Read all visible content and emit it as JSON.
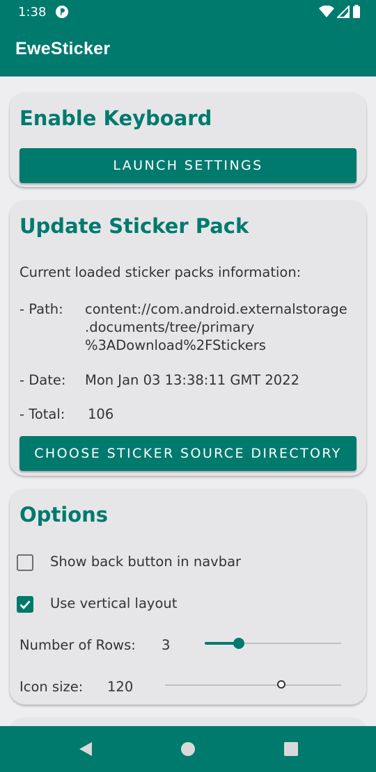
{
  "status": {
    "time": "1:38"
  },
  "app": {
    "title": "EweSticker"
  },
  "enable_keyboard": {
    "title": "Enable Keyboard",
    "button": "LAUNCH SETTINGS"
  },
  "update_pack": {
    "title": "Update Sticker Pack",
    "intro": "Current loaded sticker packs information:",
    "path_label": "- Path:",
    "path_lines": [
      "content://com.android.externalstorage",
      ".documents/tree/primary",
      "%3ADownload%2FStickers"
    ],
    "date_label": "- Date:",
    "date_value": "Mon Jan 03 13:38:11 GMT 2022",
    "total_label": "- Total:",
    "total_value": "106",
    "button": "CHOOSE STICKER SOURCE DIRECTORY"
  },
  "options": {
    "title": "Options",
    "show_back": {
      "label": "Show back button in navbar",
      "checked": false
    },
    "vertical": {
      "label": "Use vertical layout",
      "checked": true
    },
    "rows": {
      "label": "Number of Rows:",
      "value": "3",
      "fraction": 0.25
    },
    "icon_size": {
      "label": "Icon size:",
      "value": "120",
      "fraction": 0.66
    }
  },
  "colors": {
    "accent": "#017a6e",
    "card": "#e6e6e8",
    "background": "#eeeef0"
  }
}
